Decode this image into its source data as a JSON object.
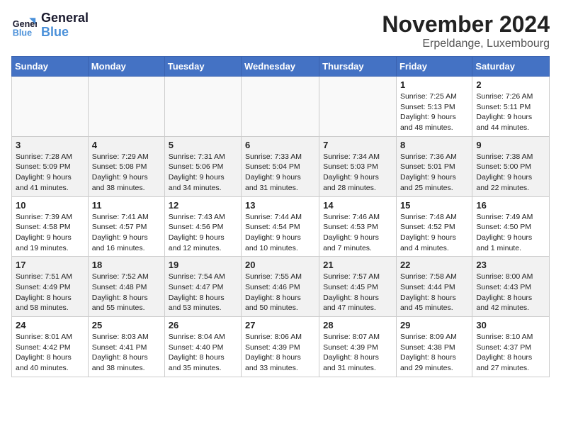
{
  "header": {
    "logo_line1": "General",
    "logo_line2": "Blue",
    "month": "November 2024",
    "location": "Erpeldange, Luxembourg"
  },
  "weekdays": [
    "Sunday",
    "Monday",
    "Tuesday",
    "Wednesday",
    "Thursday",
    "Friday",
    "Saturday"
  ],
  "weeks": [
    [
      {
        "day": "",
        "info": ""
      },
      {
        "day": "",
        "info": ""
      },
      {
        "day": "",
        "info": ""
      },
      {
        "day": "",
        "info": ""
      },
      {
        "day": "",
        "info": ""
      },
      {
        "day": "1",
        "info": "Sunrise: 7:25 AM\nSunset: 5:13 PM\nDaylight: 9 hours and 48 minutes."
      },
      {
        "day": "2",
        "info": "Sunrise: 7:26 AM\nSunset: 5:11 PM\nDaylight: 9 hours and 44 minutes."
      }
    ],
    [
      {
        "day": "3",
        "info": "Sunrise: 7:28 AM\nSunset: 5:09 PM\nDaylight: 9 hours and 41 minutes."
      },
      {
        "day": "4",
        "info": "Sunrise: 7:29 AM\nSunset: 5:08 PM\nDaylight: 9 hours and 38 minutes."
      },
      {
        "day": "5",
        "info": "Sunrise: 7:31 AM\nSunset: 5:06 PM\nDaylight: 9 hours and 34 minutes."
      },
      {
        "day": "6",
        "info": "Sunrise: 7:33 AM\nSunset: 5:04 PM\nDaylight: 9 hours and 31 minutes."
      },
      {
        "day": "7",
        "info": "Sunrise: 7:34 AM\nSunset: 5:03 PM\nDaylight: 9 hours and 28 minutes."
      },
      {
        "day": "8",
        "info": "Sunrise: 7:36 AM\nSunset: 5:01 PM\nDaylight: 9 hours and 25 minutes."
      },
      {
        "day": "9",
        "info": "Sunrise: 7:38 AM\nSunset: 5:00 PM\nDaylight: 9 hours and 22 minutes."
      }
    ],
    [
      {
        "day": "10",
        "info": "Sunrise: 7:39 AM\nSunset: 4:58 PM\nDaylight: 9 hours and 19 minutes."
      },
      {
        "day": "11",
        "info": "Sunrise: 7:41 AM\nSunset: 4:57 PM\nDaylight: 9 hours and 16 minutes."
      },
      {
        "day": "12",
        "info": "Sunrise: 7:43 AM\nSunset: 4:56 PM\nDaylight: 9 hours and 12 minutes."
      },
      {
        "day": "13",
        "info": "Sunrise: 7:44 AM\nSunset: 4:54 PM\nDaylight: 9 hours and 10 minutes."
      },
      {
        "day": "14",
        "info": "Sunrise: 7:46 AM\nSunset: 4:53 PM\nDaylight: 9 hours and 7 minutes."
      },
      {
        "day": "15",
        "info": "Sunrise: 7:48 AM\nSunset: 4:52 PM\nDaylight: 9 hours and 4 minutes."
      },
      {
        "day": "16",
        "info": "Sunrise: 7:49 AM\nSunset: 4:50 PM\nDaylight: 9 hours and 1 minute."
      }
    ],
    [
      {
        "day": "17",
        "info": "Sunrise: 7:51 AM\nSunset: 4:49 PM\nDaylight: 8 hours and 58 minutes."
      },
      {
        "day": "18",
        "info": "Sunrise: 7:52 AM\nSunset: 4:48 PM\nDaylight: 8 hours and 55 minutes."
      },
      {
        "day": "19",
        "info": "Sunrise: 7:54 AM\nSunset: 4:47 PM\nDaylight: 8 hours and 53 minutes."
      },
      {
        "day": "20",
        "info": "Sunrise: 7:55 AM\nSunset: 4:46 PM\nDaylight: 8 hours and 50 minutes."
      },
      {
        "day": "21",
        "info": "Sunrise: 7:57 AM\nSunset: 4:45 PM\nDaylight: 8 hours and 47 minutes."
      },
      {
        "day": "22",
        "info": "Sunrise: 7:58 AM\nSunset: 4:44 PM\nDaylight: 8 hours and 45 minutes."
      },
      {
        "day": "23",
        "info": "Sunrise: 8:00 AM\nSunset: 4:43 PM\nDaylight: 8 hours and 42 minutes."
      }
    ],
    [
      {
        "day": "24",
        "info": "Sunrise: 8:01 AM\nSunset: 4:42 PM\nDaylight: 8 hours and 40 minutes."
      },
      {
        "day": "25",
        "info": "Sunrise: 8:03 AM\nSunset: 4:41 PM\nDaylight: 8 hours and 38 minutes."
      },
      {
        "day": "26",
        "info": "Sunrise: 8:04 AM\nSunset: 4:40 PM\nDaylight: 8 hours and 35 minutes."
      },
      {
        "day": "27",
        "info": "Sunrise: 8:06 AM\nSunset: 4:39 PM\nDaylight: 8 hours and 33 minutes."
      },
      {
        "day": "28",
        "info": "Sunrise: 8:07 AM\nSunset: 4:39 PM\nDaylight: 8 hours and 31 minutes."
      },
      {
        "day": "29",
        "info": "Sunrise: 8:09 AM\nSunset: 4:38 PM\nDaylight: 8 hours and 29 minutes."
      },
      {
        "day": "30",
        "info": "Sunrise: 8:10 AM\nSunset: 4:37 PM\nDaylight: 8 hours and 27 minutes."
      }
    ]
  ]
}
